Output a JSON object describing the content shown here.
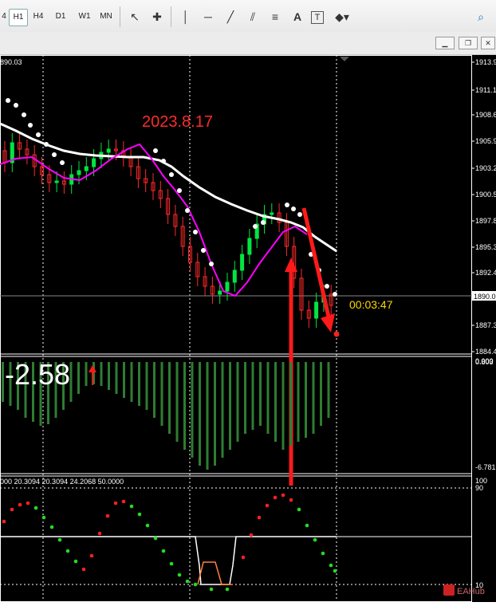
{
  "toolbar": {
    "timeframes": [
      "H1",
      "H4",
      "D1",
      "W1",
      "MN"
    ],
    "active_timeframe": "H1",
    "first_tf_partial": "4",
    "tools": [
      "cursor-icon",
      "crosshair-icon",
      "vertical-line-icon",
      "horizontal-line-icon",
      "trendline-icon",
      "channel-icon",
      "fibonacci-icon",
      "text-icon",
      "text-label-icon",
      "shapes-icon",
      "search-icon"
    ],
    "text_tool_label": "A",
    "text_label_tool_label": "T"
  },
  "window": {
    "buttons": [
      "minimize",
      "restore",
      "close"
    ]
  },
  "chart": {
    "header_price": "890.03",
    "annotation_date": "2023.8.17",
    "timer": "00:03:47",
    "current_price": "1890.0",
    "price_labels": [
      "1913.9",
      "1911.1",
      "1908.6",
      "1905.9",
      "1903.2",
      "1900.5",
      "1897.8",
      "1895.3",
      "1892.4",
      "1887.3",
      "1884.4"
    ],
    "indicator1": {
      "value_text": "-2.58",
      "right_top": "0.803",
      "right_top2": "0.000",
      "right_bottom": "-6.781"
    },
    "indicator2": {
      "header": "000  20.3094  20.3094  24.2068  50.0000",
      "levels": [
        "100",
        "90",
        "10"
      ]
    },
    "watermark": "EAHub"
  }
}
